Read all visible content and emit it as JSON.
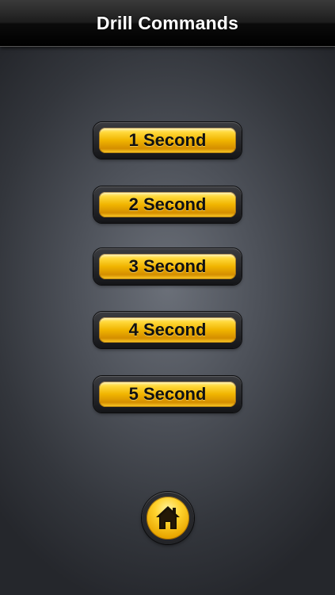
{
  "nav": {
    "title": "Drill Commands"
  },
  "commands": [
    {
      "label": "1 Second"
    },
    {
      "label": "2 Second"
    },
    {
      "label": "3 Second"
    },
    {
      "label": "4 Second"
    },
    {
      "label": "5 Second"
    }
  ],
  "home": {
    "icon": "home-icon"
  },
  "colors": {
    "accent_gold": "#f0b400",
    "nav_bar": "#000000",
    "background": "#4d5159"
  }
}
